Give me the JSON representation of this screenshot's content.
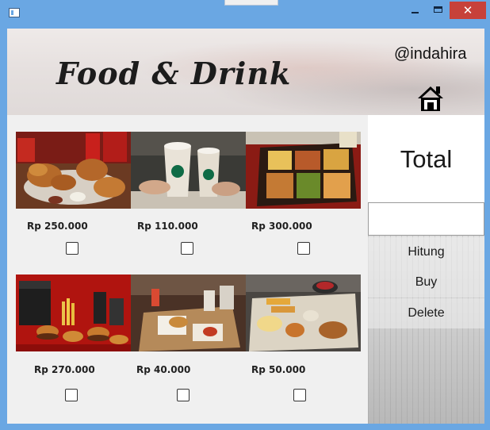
{
  "window": {
    "controls": {
      "minimize": "minimize",
      "maximize": "maximize",
      "close": "✕"
    }
  },
  "header": {
    "title": "Food & Drink",
    "handle": "@indahira",
    "home_icon": "home-icon"
  },
  "products": [
    {
      "name": "fried-chicken-bucket",
      "price": "Rp 250.000",
      "checked": false
    },
    {
      "name": "starbucks-frappuccino",
      "price": "Rp 110.000",
      "checked": false
    },
    {
      "name": "bento-box",
      "price": "Rp 300.000",
      "checked": false
    },
    {
      "name": "mcdonalds-burger-pack",
      "price": "Rp 270.000",
      "checked": false
    },
    {
      "name": "chicken-set-meal",
      "price": "Rp 40.000",
      "checked": false
    },
    {
      "name": "japanese-set-meal",
      "price": "Rp 50.000",
      "checked": false
    }
  ],
  "summary": {
    "total_label": "Total",
    "total_value": ""
  },
  "actions": {
    "hitung": "Hitung",
    "buy": "Buy",
    "delete": "Delete"
  },
  "colors": {
    "titlebar": "#6aa7e3",
    "close": "#c7413a",
    "panel": "#f0f0f0"
  }
}
